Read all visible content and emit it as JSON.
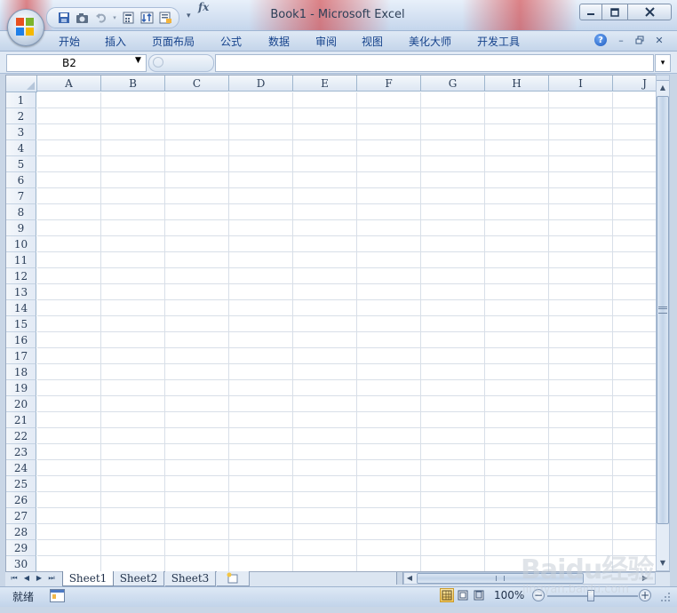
{
  "window": {
    "title": "Book1 - Microsoft Excel"
  },
  "ribbon": {
    "tabs": [
      "开始",
      "插入",
      "页面布局",
      "公式",
      "数据",
      "审阅",
      "视图",
      "美化大师",
      "开发工具"
    ]
  },
  "formula_bar": {
    "name_box": "B2",
    "fx_label": "fx",
    "formula": ""
  },
  "grid": {
    "columns": [
      "A",
      "B",
      "C",
      "D",
      "E",
      "F",
      "G",
      "H",
      "I",
      "J"
    ],
    "rows": [
      "1",
      "2",
      "3",
      "4",
      "5",
      "6",
      "7",
      "8",
      "9",
      "10",
      "11",
      "12",
      "13",
      "14",
      "15",
      "16",
      "17",
      "18",
      "19",
      "20",
      "21",
      "22",
      "23",
      "24",
      "25",
      "26",
      "27",
      "28",
      "29",
      "30"
    ]
  },
  "sheets": {
    "tabs": [
      "Sheet1",
      "Sheet2",
      "Sheet3"
    ],
    "active": "Sheet1"
  },
  "status_bar": {
    "status": "就绪",
    "zoom": "100%"
  },
  "watermark": {
    "brand": "Baidu经验",
    "url": "jingyan.baidu.com"
  },
  "colors": {
    "title_accent": "#d32a2a",
    "grid_line": "#d8dfe8",
    "header_bg": "#dde7f3",
    "active_tab": "#ffffff"
  }
}
